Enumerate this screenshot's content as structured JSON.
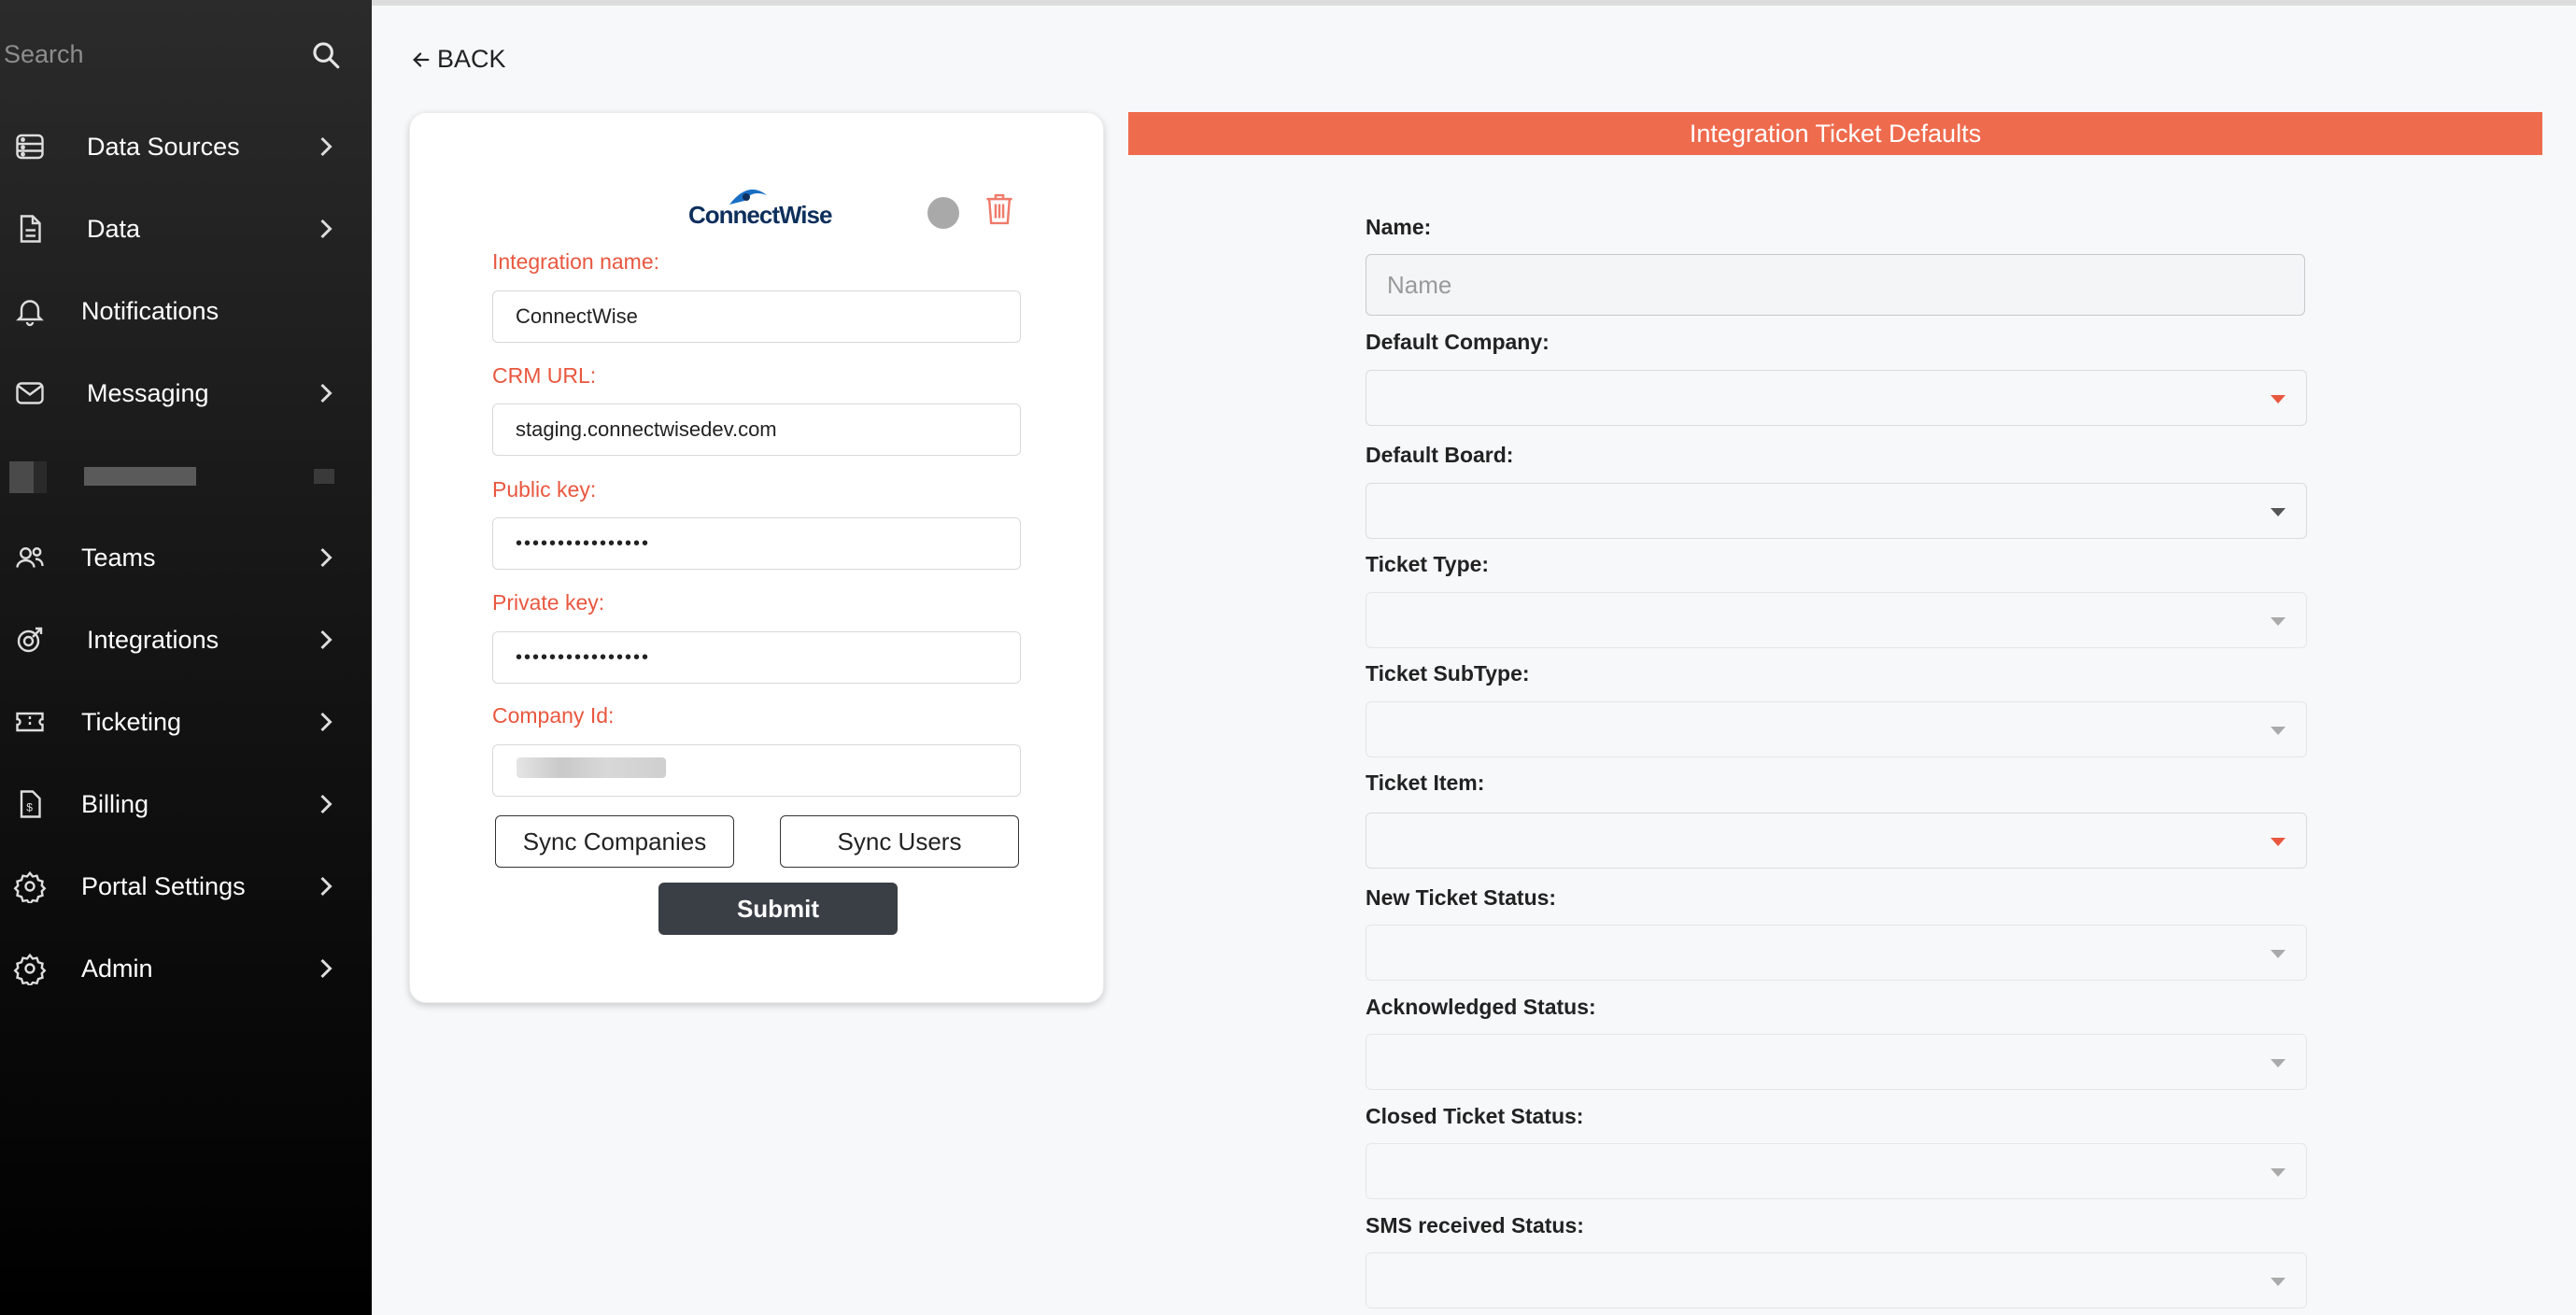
{
  "sidebar": {
    "search_placeholder": "Search",
    "items": [
      {
        "label": "Data Sources",
        "icon": "data-sources-icon"
      },
      {
        "label": "Data",
        "icon": "document-icon"
      },
      {
        "label": "Notifications",
        "icon": "bell-icon"
      },
      {
        "label": "Messaging",
        "icon": "envelope-icon"
      },
      {
        "label": "Teams",
        "icon": "users-icon"
      },
      {
        "label": "Integrations",
        "icon": "integrations-icon"
      },
      {
        "label": "Ticketing",
        "icon": "ticket-icon"
      },
      {
        "label": "Billing",
        "icon": "invoice-icon"
      },
      {
        "label": "Portal Settings",
        "icon": "gear-icon"
      },
      {
        "label": "Admin",
        "icon": "gear-icon"
      }
    ]
  },
  "back_label": "BACK",
  "integration_card": {
    "logo_text": "ConnectWise",
    "fields": {
      "integration_name": {
        "label": "Integration name:",
        "value": "ConnectWise"
      },
      "crm_url": {
        "label": "CRM URL:",
        "value": "staging.connectwisedev.com"
      },
      "public_key": {
        "label": "Public key:",
        "value": "••••••••••••••••"
      },
      "private_key": {
        "label": "Private key:",
        "value": "••••••••••••••••"
      },
      "company_id": {
        "label": "Company Id:",
        "value": ""
      }
    },
    "sync_companies_label": "Sync Companies",
    "sync_users_label": "Sync Users",
    "submit_label": "Submit"
  },
  "defaults_panel": {
    "title": "Integration Ticket Defaults",
    "name_label": "Name:",
    "name_placeholder": "Name",
    "selects": [
      {
        "label": "Default Company:",
        "value": ""
      },
      {
        "label": "Default Board:",
        "value": ""
      },
      {
        "label": "Ticket Type:",
        "value": ""
      },
      {
        "label": "Ticket SubType:",
        "value": ""
      },
      {
        "label": "Ticket Item:",
        "value": ""
      },
      {
        "label": "New Ticket Status:",
        "value": ""
      },
      {
        "label": "Acknowledged Status:",
        "value": ""
      },
      {
        "label": "Closed Ticket Status:",
        "value": ""
      },
      {
        "label": "SMS received Status:",
        "value": ""
      }
    ]
  },
  "colors": {
    "accent": "#ef6b4d",
    "label_red": "#e9573f",
    "submit_bg": "#3a3e45",
    "sidebar_bg": "#000000"
  }
}
